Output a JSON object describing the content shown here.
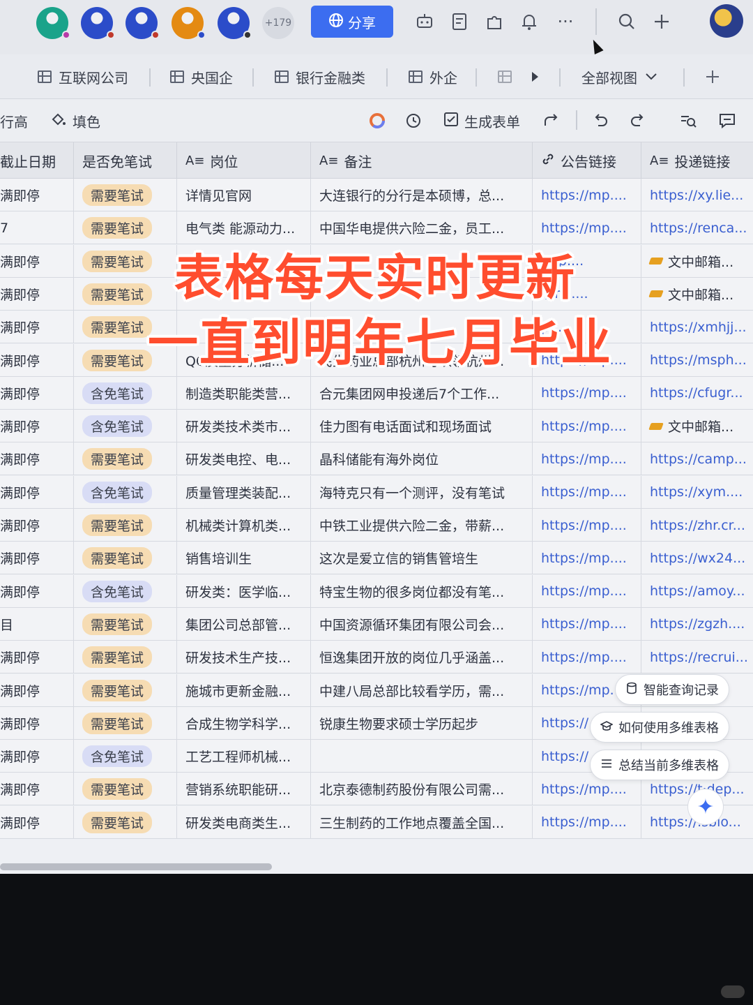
{
  "topbar": {
    "more_collaborators": "+179",
    "share_label": "分享",
    "avatar_colors": [
      "#1aa38a",
      "#2b4cc9",
      "#2b4cc9",
      "#e48a12",
      "#2b4cc9"
    ],
    "avatar_dot_colors": [
      "#b93aa8",
      "#c0392b",
      "#c0392b",
      "#2b4cc9",
      "#333333"
    ]
  },
  "tabs": {
    "items": [
      "互联网公司",
      "央国企",
      "银行金融类",
      "外企"
    ],
    "view_label": "全部视图"
  },
  "toolbar": {
    "row_height": "行高",
    "fill_color": "填色",
    "generate_form": "生成表单"
  },
  "table": {
    "headers": [
      "截止日期",
      "是否免笔试",
      "岗位",
      "备注",
      "公告链接",
      "投递链接"
    ],
    "rows": [
      {
        "deadline": "满即停",
        "exam": "需要笔试",
        "exam_type": "need",
        "post": "详情见官网",
        "note": "大连银行的分行是本硕博，总...",
        "notice": "https://mp....",
        "apply": "https://xy.lie...",
        "apply_mail": false
      },
      {
        "deadline": "7",
        "exam": "需要笔试",
        "exam_type": "need",
        "post": "电气类 能源动力...",
        "note": "中国华电提供六险二金，员工...",
        "notice": "https://mp....",
        "apply": "https://renca...",
        "apply_mail": false
      },
      {
        "deadline": "满即停",
        "exam": "需要笔试",
        "exam_type": "need",
        "post": "",
        "note": "",
        "notice": "/mp....",
        "apply": "文中邮箱...",
        "apply_mail": true
      },
      {
        "deadline": "满即停",
        "exam": "需要笔试",
        "exam_type": "need",
        "post": "",
        "note": "",
        "notice": "//mp....",
        "apply": "文中邮箱...",
        "apply_mail": true
      },
      {
        "deadline": "满即停",
        "exam": "需要笔试",
        "exam_type": "need",
        "post": "",
        "note": "",
        "notice": "p....",
        "apply": "https://xmhjj...",
        "apply_mail": false
      },
      {
        "deadline": "满即停",
        "exam": "需要笔试",
        "exam_type": "need",
        "post": "QC质量分析储...",
        "note": "民生药业总部杭州可以领杭州...",
        "notice": "https://mp....",
        "apply": "https://msph...",
        "apply_mail": false
      },
      {
        "deadline": "满即停",
        "exam": "含免笔试",
        "exam_type": "free",
        "post": "制造类职能类营...",
        "note": "合元集团网申投递后7个工作...",
        "notice": "https://mp....",
        "apply": "https://cfugr...",
        "apply_mail": false
      },
      {
        "deadline": "满即停",
        "exam": "含免笔试",
        "exam_type": "free",
        "post": "研发类技术类市...",
        "note": "佳力图有电话面试和现场面试",
        "notice": "https://mp....",
        "apply": "文中邮箱...",
        "apply_mail": true
      },
      {
        "deadline": "满即停",
        "exam": "需要笔试",
        "exam_type": "need",
        "post": "研发类电控、电...",
        "note": "晶科储能有海外岗位",
        "notice": "https://mp....",
        "apply": "https://camp...",
        "apply_mail": false
      },
      {
        "deadline": "满即停",
        "exam": "含免笔试",
        "exam_type": "free",
        "post": "质量管理类装配...",
        "note": "海特克只有一个测评，没有笔试",
        "notice": "https://mp....",
        "apply": "https://xym....",
        "apply_mail": false
      },
      {
        "deadline": "满即停",
        "exam": "需要笔试",
        "exam_type": "need",
        "post": "机械类计算机类...",
        "note": "中铁工业提供六险二金，带薪...",
        "notice": "https://mp....",
        "apply": "https://zhr.cr...",
        "apply_mail": false
      },
      {
        "deadline": "满即停",
        "exam": "需要笔试",
        "exam_type": "need",
        "post": "销售培训生",
        "note": "这次是爱立信的销售管培生",
        "notice": "https://mp....",
        "apply": "https://wx24...",
        "apply_mail": false
      },
      {
        "deadline": "满即停",
        "exam": "含免笔试",
        "exam_type": "free",
        "post": "研发类：医学临...",
        "note": "特宝生物的很多岗位都没有笔...",
        "notice": "https://mp....",
        "apply": "https://amoy...",
        "apply_mail": false
      },
      {
        "deadline": "目",
        "exam": "需要笔试",
        "exam_type": "need",
        "post": "集团公司总部管...",
        "note": "中国资源循环集团有限公司会...",
        "notice": "https://mp....",
        "apply": "https://zgzh....",
        "apply_mail": false
      },
      {
        "deadline": "满即停",
        "exam": "需要笔试",
        "exam_type": "need",
        "post": "研发技术生产技...",
        "note": "恒逸集团开放的岗位几乎涵盖...",
        "notice": "https://mp....",
        "apply": "https://recrui...",
        "apply_mail": false
      },
      {
        "deadline": "满即停",
        "exam": "需要笔试",
        "exam_type": "need",
        "post": "施城市更新金融...",
        "note": "中建八局总部比较看学历，需...",
        "notice": "https://mp.",
        "apply": "c...",
        "apply_mail": false
      },
      {
        "deadline": "满即停",
        "exam": "需要笔试",
        "exam_type": "need",
        "post": "合成生物学科学...",
        "note": "锐康生物要求硕士学历起步",
        "notice": "https://",
        "apply": "l....",
        "apply_mail": false
      },
      {
        "deadline": "满即停",
        "exam": "含免笔试",
        "exam_type": "free",
        "post": "工艺工程师机械...",
        "note": "",
        "notice": "https://",
        "apply": "...",
        "apply_mail": false
      },
      {
        "deadline": "满即停",
        "exam": "需要笔试",
        "exam_type": "need",
        "post": "营销系统职能研...",
        "note": "北京泰德制药股份有限公司需...",
        "notice": "https://mp....",
        "apply": "https://t·dep...",
        "apply_mail": false
      },
      {
        "deadline": "满即停",
        "exam": "需要笔试",
        "exam_type": "need",
        "post": "研发类电商类生...",
        "note": "三生制药的工作地点覆盖全国...",
        "notice": "https://mp....",
        "apply": "https://.sbio...",
        "apply_mail": false
      }
    ]
  },
  "overlay": {
    "line1": "表格每天实时更新",
    "line2": "一直到明年七月毕业"
  },
  "ai_menu": {
    "query_history": "智能查询记录",
    "how_to_use": "如何使用多维表格",
    "summarize": "总结当前多维表格"
  }
}
